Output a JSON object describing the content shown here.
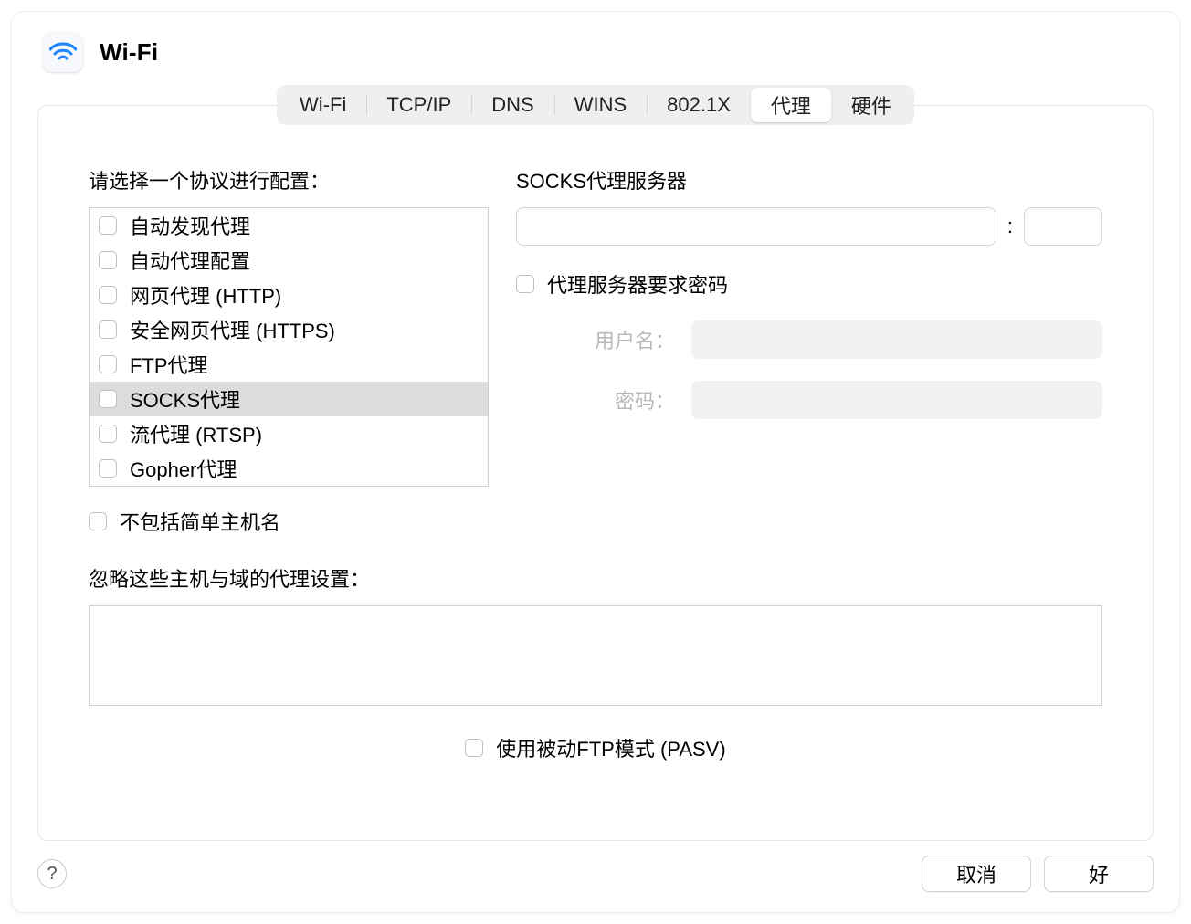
{
  "header": {
    "title": "Wi-Fi"
  },
  "tabs": {
    "items": [
      {
        "label": "Wi-Fi"
      },
      {
        "label": "TCP/IP"
      },
      {
        "label": "DNS"
      },
      {
        "label": "WINS"
      },
      {
        "label": "802.1X"
      },
      {
        "label": "代理"
      },
      {
        "label": "硬件"
      }
    ],
    "active_index": 5
  },
  "proxy": {
    "protocol_list_label": "请选择一个协议进行配置：",
    "protocols": [
      {
        "label": "自动发现代理",
        "checked": false,
        "selected": false
      },
      {
        "label": "自动代理配置",
        "checked": false,
        "selected": false
      },
      {
        "label": "网页代理 (HTTP)",
        "checked": false,
        "selected": false
      },
      {
        "label": "安全网页代理 (HTTPS)",
        "checked": false,
        "selected": false
      },
      {
        "label": "FTP代理",
        "checked": false,
        "selected": false
      },
      {
        "label": "SOCKS代理",
        "checked": false,
        "selected": true
      },
      {
        "label": "流代理 (RTSP)",
        "checked": false,
        "selected": false
      },
      {
        "label": "Gopher代理",
        "checked": false,
        "selected": false
      }
    ],
    "server_section_label": "SOCKS代理服务器",
    "host_value": "",
    "port_value": "",
    "port_separator": ":",
    "requires_password_label": "代理服务器要求密码",
    "requires_password_checked": false,
    "username_label": "用户名：",
    "username_value": "",
    "password_label": "密码：",
    "password_value": "",
    "exclude_simple_label": "不包括简单主机名",
    "exclude_simple_checked": false,
    "bypass_label": "忽略这些主机与域的代理设置：",
    "bypass_value": "",
    "pasv_label": "使用被动FTP模式 (PASV)",
    "pasv_checked": false
  },
  "footer": {
    "help": "?",
    "cancel": "取消",
    "ok": "好"
  }
}
